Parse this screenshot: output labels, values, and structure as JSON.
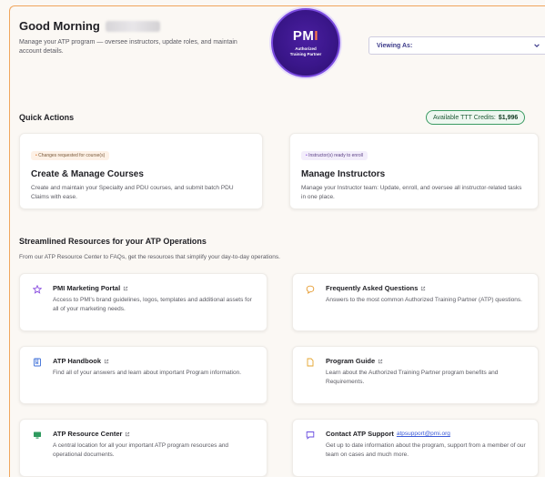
{
  "header": {
    "greeting": "Good Morning",
    "subtitle": "Manage your ATP program — oversee instructors, update roles, and maintain account details.",
    "badge": {
      "logo_a": "PM",
      "logo_b": "I",
      "line1": "Authorized",
      "line2": "Training Partner"
    },
    "viewing_as": {
      "label": "Viewing As:"
    }
  },
  "quick_actions": {
    "title": "Quick Actions",
    "credits_label": "Available TTT Credits:",
    "credits_value": "$1,996",
    "cards": [
      {
        "tag": "Changes requested for course(s)",
        "title": "Create & Manage Courses",
        "desc": "Create and maintain your Specialty and PDU courses, and submit batch PDU Claims with ease."
      },
      {
        "tag": "Instructor(s) ready to enroll",
        "title": "Manage Instructors",
        "desc": "Manage your Instructor team: Update, enroll, and oversee all instructor-related tasks in one place."
      }
    ]
  },
  "resources": {
    "title": "Streamlined Resources for your ATP Operations",
    "subtitle": "From our ATP Resource Center to FAQs, get the resources that simplify your day-to-day operations.",
    "items": [
      {
        "icon": "star-icon",
        "title": "PMI Marketing Portal",
        "desc": "Access to PMI's brand guidelines, logos, templates and additional assets for all of your marketing needs."
      },
      {
        "icon": "chat-bubble-icon",
        "title": "Frequently Asked Questions",
        "desc": "Answers to the most common Authorized Training Partner (ATP) questions."
      },
      {
        "icon": "book-icon",
        "title": "ATP Handbook",
        "desc": "Find all of your answers and learn about important Program information."
      },
      {
        "icon": "document-icon",
        "title": "Program Guide",
        "desc": "Learn about the Authorized Training Partner program benefits and Requirements."
      },
      {
        "icon": "monitor-icon",
        "title": "ATP Resource Center",
        "desc": "A central location for all your important ATP program resources and operational documents."
      },
      {
        "icon": "message-icon",
        "title": "Contact ATP Support",
        "link": "atpsupport@pmi.org",
        "desc": "Get up to date information about the program, support from a member of our team on cases and much more."
      }
    ]
  },
  "colors": {
    "accent_orange": "#f0a55c",
    "brand_purple": "#4a1fa0",
    "credit_green": "#3c9b63",
    "link_blue": "#3c5bd8"
  }
}
